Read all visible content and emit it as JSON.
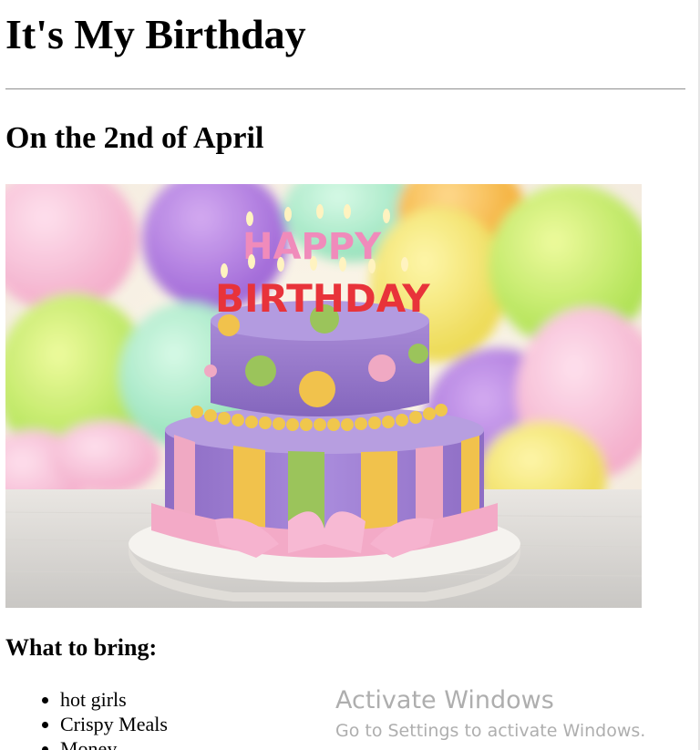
{
  "page": {
    "title": "It's My Birthday",
    "date_heading": "On the 2nd of April",
    "bring_heading": "What to bring:",
    "bring_items": [
      "hot girls",
      "Crispy Meals",
      "Money"
    ]
  },
  "image": {
    "description_icon": "birthday-cake-image",
    "candle_text_1": "HAPPY",
    "candle_text_2": "BIRTHDAY"
  },
  "watermark": {
    "title": "Activate Windows",
    "subtitle": "Go to Settings to activate Windows."
  }
}
